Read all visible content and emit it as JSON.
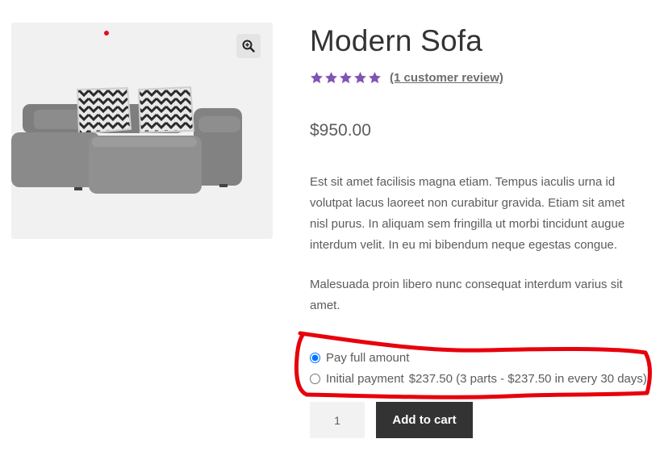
{
  "product": {
    "title": "Modern Sofa",
    "rating": {
      "value": 5,
      "max": 5,
      "review_link": "(1 customer review)"
    },
    "price": "$950.00",
    "description": [
      "Est sit amet facilisis magna etiam. Tempus iaculis urna id volutpat lacus laoreet non curabitur gravida. Etiam sit amet nisl purus. In aliquam sem fringilla ut morbi tincidunt augue interdum velit. In eu mi bibendum neque egestas congue.",
      "Malesuada proin libero nunc consequat interdum varius sit amet."
    ]
  },
  "gallery": {
    "zoom_icon": "magnifier-plus-icon",
    "image": "gray sofa with chevron pillows"
  },
  "payment_options": {
    "full": {
      "label": "Pay full amount",
      "selected": true
    },
    "initial": {
      "label": "Initial payment",
      "amount": "$237.50 (3 parts - $237.50 in every 30 days)",
      "selected": false
    }
  },
  "cart": {
    "quantity": "1",
    "add_to_cart_label": "Add to cart"
  },
  "colors": {
    "star": "#7f54b3",
    "button_bg": "#333333",
    "annotation": "#e8000b"
  }
}
